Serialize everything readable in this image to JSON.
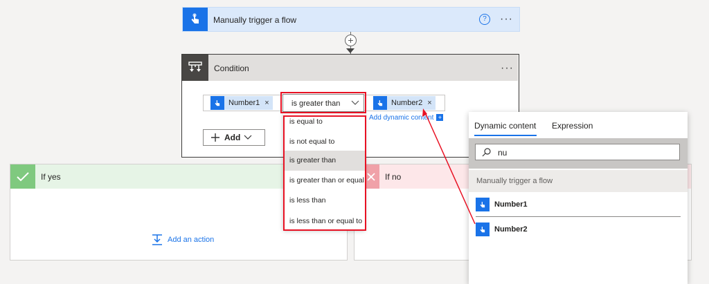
{
  "trigger": {
    "title": "Manually trigger a flow",
    "help": "?",
    "more": "···"
  },
  "connector": {
    "plus": "+"
  },
  "condition": {
    "title": "Condition",
    "more": "···",
    "left_token": "Number1",
    "operator_value": "is greater than",
    "right_token": "Number2",
    "token_remove": "×",
    "add_dynamic": "Add dynamic content",
    "add_dynamic_plus": "+",
    "add_label": "Add"
  },
  "operator_options": [
    "is equal to",
    "is not equal to",
    "is greater than",
    "is greater than or equal to",
    "is less than",
    "is less than or equal to"
  ],
  "if_yes": {
    "title": "If yes",
    "add_action": "Add an action"
  },
  "if_no": {
    "title": "If no"
  },
  "dynamic_panel": {
    "tabs": [
      "Dynamic content",
      "Expression"
    ],
    "search_value": "nu",
    "section": "Manually trigger a flow",
    "items": [
      "Number1",
      "Number2"
    ]
  },
  "colors": {
    "accent": "#1a73e8",
    "highlight": "#e81123"
  },
  "icons": [
    "touch-icon",
    "help-icon",
    "more-icon",
    "condition-icon",
    "check-icon",
    "close-icon",
    "chevron-down-icon",
    "search-icon",
    "add-action-icon"
  ]
}
